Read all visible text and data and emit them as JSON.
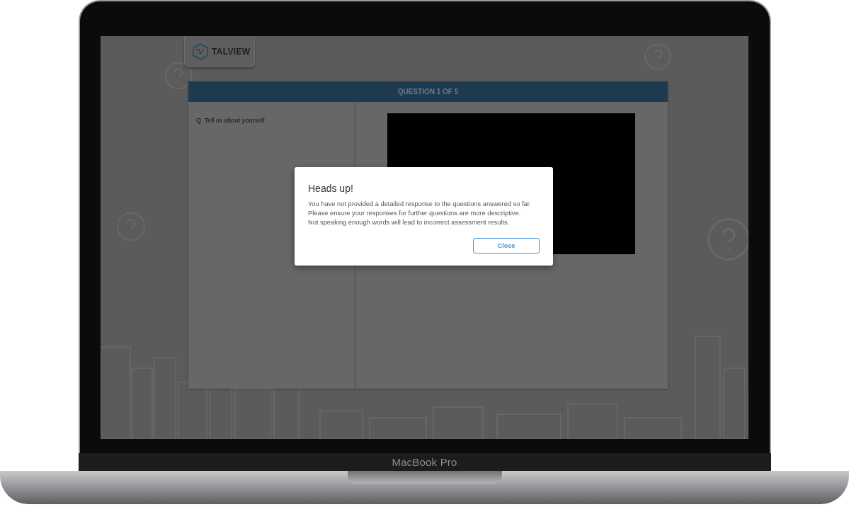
{
  "brand": {
    "name": "TALVIEW"
  },
  "question": {
    "header": "QUESTION 1 OF 5",
    "prompt": "Q. Tell us about yourself."
  },
  "dialog": {
    "title": "Heads up!",
    "lines": [
      "You have not provided a detailed response to the questions answered so far.",
      "Please ensure your responses for further questions are more descriptive.",
      "Not speaking enough words will lead to incorrect assessment results."
    ],
    "button": "Close"
  },
  "device": {
    "label": "MacBook Pro"
  }
}
